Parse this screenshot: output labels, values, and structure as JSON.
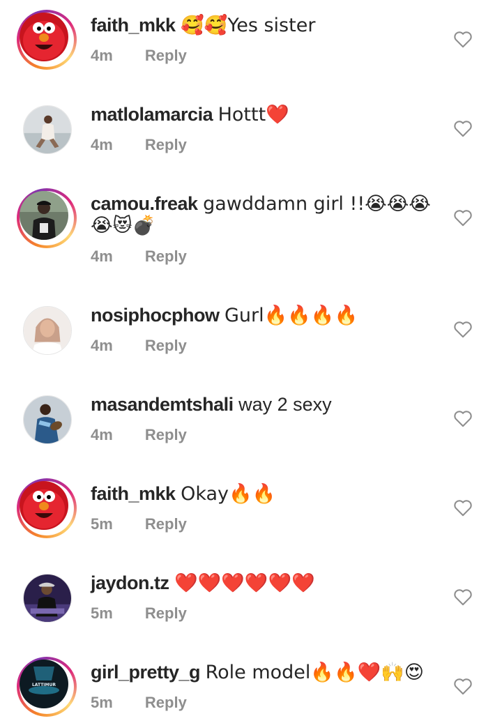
{
  "comments": [
    {
      "username": "faith_mkk",
      "text": "🥰🥰Yes sister",
      "time": "4m",
      "reply": "Reply",
      "avatar": "elmo-avatar",
      "story_ring": true
    },
    {
      "username": "matlolamarcia",
      "text": "Hottt❤️",
      "time": "4m",
      "reply": "Reply",
      "avatar": "woman-sitting-avatar",
      "story_ring": false
    },
    {
      "username": "camou.freak",
      "text": "gawddamn girl !!😭😭😭",
      "text2": "😭😻💣",
      "time": "4m",
      "reply": "Reply",
      "avatar": "man-cap-avatar",
      "story_ring": true
    },
    {
      "username": "nosiphocphow",
      "text": "Gurl🔥🔥🔥🔥",
      "time": "4m",
      "reply": "Reply",
      "avatar": "woman-portrait-avatar",
      "story_ring": false
    },
    {
      "username": "masandemtshali",
      "text": "way 2 sexy",
      "time": "4m",
      "reply": "Reply",
      "avatar": "rugby-player-avatar",
      "story_ring": false
    },
    {
      "username": "faith_mkk",
      "text": "Okay🔥🔥",
      "time": "5m",
      "reply": "Reply",
      "avatar": "elmo-avatar",
      "story_ring": true
    },
    {
      "username": "jaydon.tz",
      "text": "❤️❤️❤️❤️❤️❤️",
      "time": "5m",
      "reply": "Reply",
      "avatar": "man-purple-avatar",
      "story_ring": false
    },
    {
      "username": "girl_pretty_g",
      "text": "Role model🔥🔥❤️🙌😍",
      "time": "5m",
      "reply": "Reply",
      "avatar": "lattimur-logo-avatar",
      "avatar_text": "LATTIMUR",
      "story_ring": true
    }
  ],
  "colors": {
    "text": "#262626",
    "meta": "#8e8e8e",
    "heart_outline": "#8e8e8e"
  }
}
